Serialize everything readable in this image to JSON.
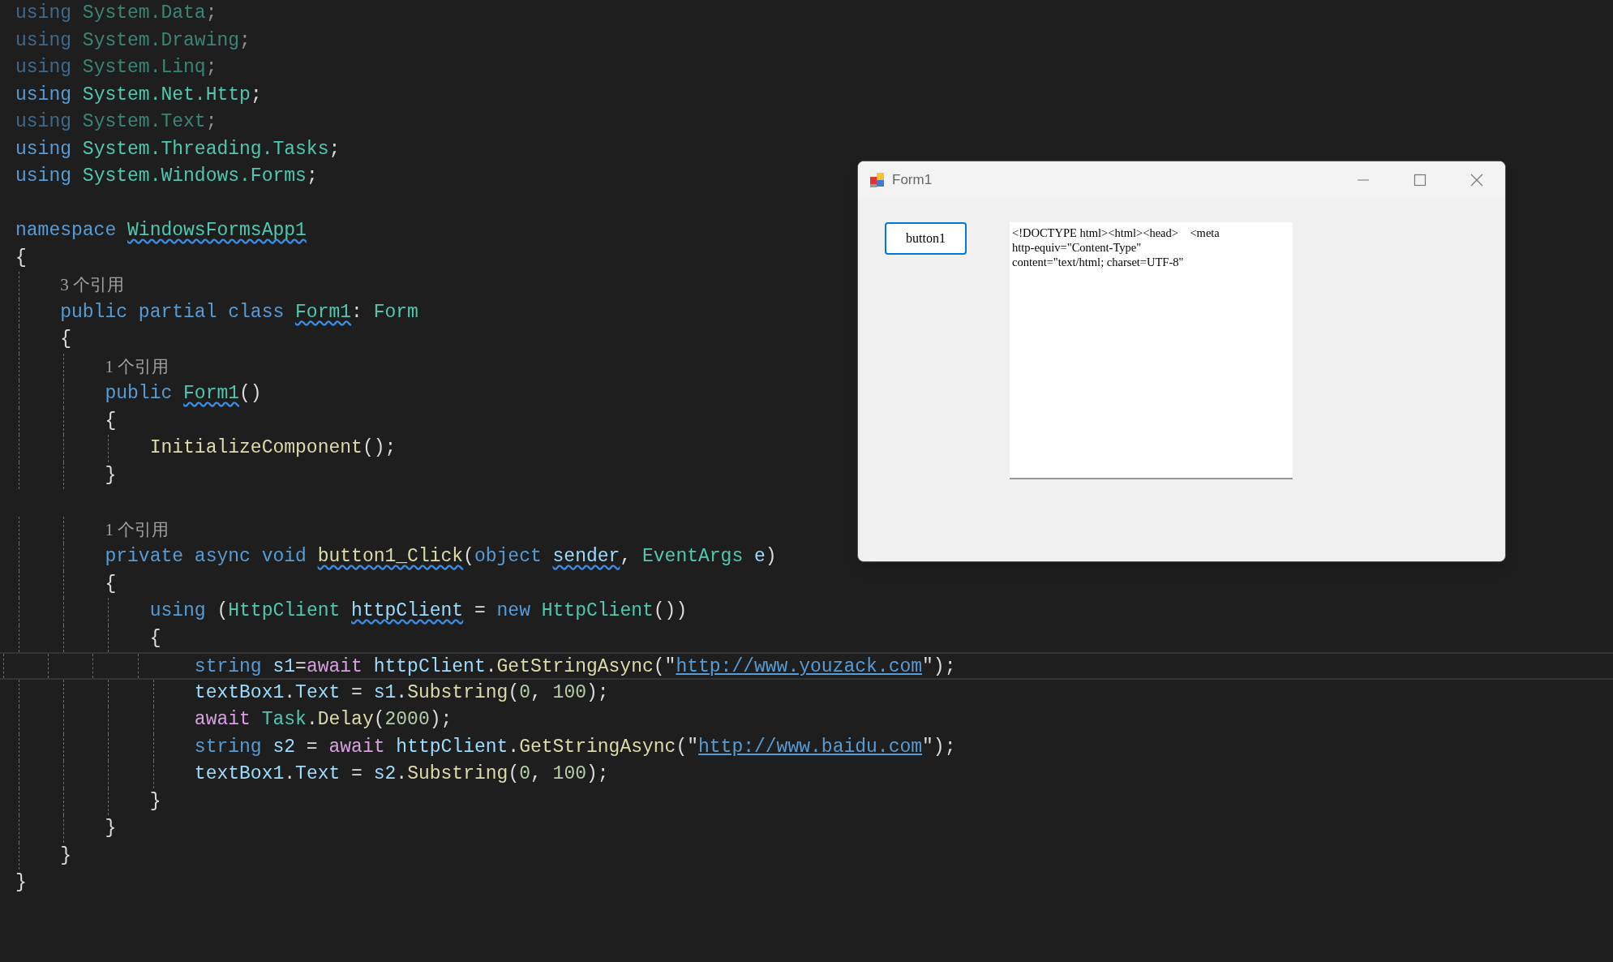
{
  "editor": {
    "lines": [
      {
        "kind": "code",
        "dimmed": true,
        "current": false,
        "tokens": [
          {
            "text": "using ",
            "kind": "keyword"
          },
          {
            "text": "System.Data",
            "kind": "type"
          },
          {
            "text": ";",
            "kind": "plain"
          }
        ]
      },
      {
        "kind": "code",
        "dimmed": true,
        "current": false,
        "tokens": [
          {
            "text": "using ",
            "kind": "keyword"
          },
          {
            "text": "System.Drawing",
            "kind": "type"
          },
          {
            "text": ";",
            "kind": "plain"
          }
        ]
      },
      {
        "kind": "code",
        "dimmed": true,
        "current": false,
        "tokens": [
          {
            "text": "using ",
            "kind": "keyword"
          },
          {
            "text": "System.Linq",
            "kind": "type"
          },
          {
            "text": ";",
            "kind": "plain"
          }
        ]
      },
      {
        "kind": "code",
        "dimmed": false,
        "current": false,
        "tokens": [
          {
            "text": "using ",
            "kind": "keyword"
          },
          {
            "text": "System.Net.Http",
            "kind": "type"
          },
          {
            "text": ";",
            "kind": "plain"
          }
        ]
      },
      {
        "kind": "code",
        "dimmed": true,
        "current": false,
        "tokens": [
          {
            "text": "using ",
            "kind": "keyword"
          },
          {
            "text": "System.Text",
            "kind": "type"
          },
          {
            "text": ";",
            "kind": "plain"
          }
        ]
      },
      {
        "kind": "code",
        "dimmed": false,
        "current": false,
        "tokens": [
          {
            "text": "using ",
            "kind": "keyword"
          },
          {
            "text": "System.Threading.Tasks",
            "kind": "type"
          },
          {
            "text": ";",
            "kind": "plain"
          }
        ]
      },
      {
        "kind": "code",
        "dimmed": false,
        "current": false,
        "tokens": [
          {
            "text": "using ",
            "kind": "keyword"
          },
          {
            "text": "System.Windows.Forms",
            "kind": "type"
          },
          {
            "text": ";",
            "kind": "plain"
          }
        ]
      },
      {
        "kind": "blank"
      },
      {
        "kind": "code",
        "dimmed": false,
        "current": false,
        "tokens": [
          {
            "text": "namespace ",
            "kind": "keyword"
          },
          {
            "text": "WindowsFormsApp1",
            "kind": "type",
            "error": true
          }
        ]
      },
      {
        "kind": "code",
        "dimmed": false,
        "current": false,
        "tokens": [
          {
            "text": "{",
            "kind": "plain"
          }
        ]
      },
      {
        "kind": "codelens",
        "text": "    3 个引用"
      },
      {
        "kind": "code",
        "dimmed": false,
        "current": false,
        "tokens": [
          {
            "text": "    public partial class ",
            "kind": "keyword"
          },
          {
            "text": "Form1",
            "kind": "type",
            "error": true
          },
          {
            "text": ": ",
            "kind": "plain"
          },
          {
            "text": "Form",
            "kind": "type"
          }
        ]
      },
      {
        "kind": "code",
        "dimmed": false,
        "current": false,
        "tokens": [
          {
            "text": "    {",
            "kind": "plain"
          }
        ]
      },
      {
        "kind": "codelens",
        "text": "        1 个引用"
      },
      {
        "kind": "code",
        "dimmed": false,
        "current": false,
        "tokens": [
          {
            "text": "        public ",
            "kind": "keyword"
          },
          {
            "text": "Form1",
            "kind": "type",
            "error": true
          },
          {
            "text": "()",
            "kind": "plain"
          }
        ]
      },
      {
        "kind": "code",
        "dimmed": false,
        "current": false,
        "tokens": [
          {
            "text": "        {",
            "kind": "plain"
          }
        ]
      },
      {
        "kind": "code",
        "dimmed": false,
        "current": false,
        "tokens": [
          {
            "text": "            InitializeComponent",
            "kind": "method"
          },
          {
            "text": "();",
            "kind": "plain"
          }
        ]
      },
      {
        "kind": "code",
        "dimmed": false,
        "current": false,
        "tokens": [
          {
            "text": "        }",
            "kind": "plain"
          }
        ]
      },
      {
        "kind": "blank"
      },
      {
        "kind": "codelens",
        "text": "        1 个引用"
      },
      {
        "kind": "code",
        "dimmed": false,
        "current": false,
        "tokens": [
          {
            "text": "        private async void ",
            "kind": "keyword"
          },
          {
            "text": "button1_Click",
            "kind": "method",
            "error": true
          },
          {
            "text": "(",
            "kind": "plain"
          },
          {
            "text": "object ",
            "kind": "keyword"
          },
          {
            "text": "sender",
            "kind": "variable",
            "error": true
          },
          {
            "text": ", ",
            "kind": "plain"
          },
          {
            "text": "EventArgs ",
            "kind": "type"
          },
          {
            "text": "e",
            "kind": "variable"
          },
          {
            "text": ")",
            "kind": "plain"
          }
        ]
      },
      {
        "kind": "code",
        "dimmed": false,
        "current": false,
        "tokens": [
          {
            "text": "        {",
            "kind": "plain"
          }
        ]
      },
      {
        "kind": "code",
        "dimmed": false,
        "current": false,
        "tokens": [
          {
            "text": "            using ",
            "kind": "keyword"
          },
          {
            "text": "(",
            "kind": "plain"
          },
          {
            "text": "HttpClient ",
            "kind": "type"
          },
          {
            "text": "httpClient",
            "kind": "variable",
            "error": true
          },
          {
            "text": " = ",
            "kind": "plain"
          },
          {
            "text": "new ",
            "kind": "keyword"
          },
          {
            "text": "HttpClient",
            "kind": "type"
          },
          {
            "text": "())",
            "kind": "plain"
          }
        ]
      },
      {
        "kind": "code",
        "dimmed": false,
        "current": false,
        "tokens": [
          {
            "text": "            {",
            "kind": "plain"
          }
        ]
      },
      {
        "kind": "code",
        "dimmed": false,
        "current": true,
        "tokens": [
          {
            "text": "                string ",
            "kind": "keyword"
          },
          {
            "text": "s1",
            "kind": "variable"
          },
          {
            "text": "=",
            "kind": "plain"
          },
          {
            "text": "await ",
            "kind": "control"
          },
          {
            "text": "httpClient",
            "kind": "variable"
          },
          {
            "text": ".",
            "kind": "plain"
          },
          {
            "text": "GetStringAsync",
            "kind": "method"
          },
          {
            "text": "(\"",
            "kind": "plain"
          },
          {
            "text": "http://www.youzack.com",
            "kind": "link"
          },
          {
            "text": "\");",
            "kind": "plain"
          }
        ]
      },
      {
        "kind": "code",
        "dimmed": false,
        "current": false,
        "tokens": [
          {
            "text": "                textBox1",
            "kind": "variable"
          },
          {
            "text": ".",
            "kind": "plain"
          },
          {
            "text": "Text",
            "kind": "variable"
          },
          {
            "text": " = ",
            "kind": "plain"
          },
          {
            "text": "s1",
            "kind": "variable"
          },
          {
            "text": ".",
            "kind": "plain"
          },
          {
            "text": "Substring",
            "kind": "method"
          },
          {
            "text": "(",
            "kind": "plain"
          },
          {
            "text": "0",
            "kind": "number"
          },
          {
            "text": ", ",
            "kind": "plain"
          },
          {
            "text": "100",
            "kind": "number"
          },
          {
            "text": ");",
            "kind": "plain"
          }
        ]
      },
      {
        "kind": "code",
        "dimmed": false,
        "current": false,
        "tokens": [
          {
            "text": "                await ",
            "kind": "control"
          },
          {
            "text": "Task",
            "kind": "type"
          },
          {
            "text": ".",
            "kind": "plain"
          },
          {
            "text": "Delay",
            "kind": "method"
          },
          {
            "text": "(",
            "kind": "plain"
          },
          {
            "text": "2000",
            "kind": "number"
          },
          {
            "text": ");",
            "kind": "plain"
          }
        ]
      },
      {
        "kind": "code",
        "dimmed": false,
        "current": false,
        "tokens": [
          {
            "text": "                string ",
            "kind": "keyword"
          },
          {
            "text": "s2",
            "kind": "variable"
          },
          {
            "text": " = ",
            "kind": "plain"
          },
          {
            "text": "await ",
            "kind": "control"
          },
          {
            "text": "httpClient",
            "kind": "variable"
          },
          {
            "text": ".",
            "kind": "plain"
          },
          {
            "text": "GetStringAsync",
            "kind": "method"
          },
          {
            "text": "(\"",
            "kind": "plain"
          },
          {
            "text": "http://www.baidu.com",
            "kind": "link"
          },
          {
            "text": "\");",
            "kind": "plain"
          }
        ]
      },
      {
        "kind": "code",
        "dimmed": false,
        "current": false,
        "tokens": [
          {
            "text": "                textBox1",
            "kind": "variable"
          },
          {
            "text": ".",
            "kind": "plain"
          },
          {
            "text": "Text",
            "kind": "variable"
          },
          {
            "text": " = ",
            "kind": "plain"
          },
          {
            "text": "s2",
            "kind": "variable"
          },
          {
            "text": ".",
            "kind": "plain"
          },
          {
            "text": "Substring",
            "kind": "method"
          },
          {
            "text": "(",
            "kind": "plain"
          },
          {
            "text": "0",
            "kind": "number"
          },
          {
            "text": ", ",
            "kind": "plain"
          },
          {
            "text": "100",
            "kind": "number"
          },
          {
            "text": ");",
            "kind": "plain"
          }
        ]
      },
      {
        "kind": "code",
        "dimmed": false,
        "current": false,
        "tokens": [
          {
            "text": "            }",
            "kind": "plain"
          }
        ]
      },
      {
        "kind": "code",
        "dimmed": false,
        "current": false,
        "tokens": [
          {
            "text": "        }",
            "kind": "plain"
          }
        ]
      },
      {
        "kind": "code",
        "dimmed": false,
        "current": false,
        "tokens": [
          {
            "text": "    }",
            "kind": "plain"
          }
        ]
      },
      {
        "kind": "code",
        "dimmed": false,
        "current": false,
        "tokens": [
          {
            "text": "}",
            "kind": "plain"
          }
        ]
      }
    ]
  },
  "form_window": {
    "title": "Form1",
    "button": "button1",
    "textbox_lines": [
      "<!DOCTYPE html><html><head>    <meta",
      "http-equiv=\"Content-Type\"",
      "content=\"text/html; charset=UTF-8\""
    ]
  }
}
